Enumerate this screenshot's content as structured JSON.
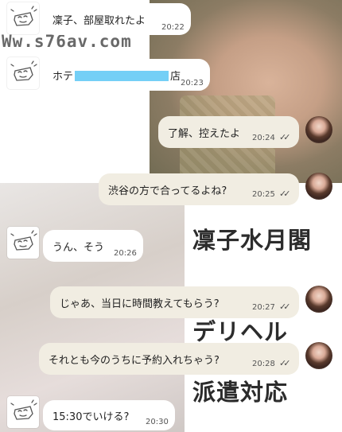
{
  "watermark": "Ww.s76av.com",
  "poster": {
    "line1": "凜子水月閣",
    "line2": "デリヘル",
    "line3": "派遣対応"
  },
  "messages": [
    {
      "from": "shop",
      "text": "凜子、部屋取れたよ",
      "time": "20:22"
    },
    {
      "from": "shop",
      "text_before": "ホテ",
      "text_after": "店",
      "time": "20:23"
    },
    {
      "from": "user",
      "text": "了解、控えたよ",
      "time": "20:24",
      "status": "read"
    },
    {
      "from": "user",
      "text": "渋谷の方で合ってるよね?",
      "time": "20:25",
      "status": "read"
    },
    {
      "from": "shop",
      "text": "うん、そう",
      "time": "20:26"
    },
    {
      "from": "user",
      "text": "じゃあ、当日に時間教えてもらう?",
      "time": "20:27",
      "status": "read"
    },
    {
      "from": "user",
      "text": "それとも今のうちに予約入れちゃう?",
      "time": "20:28",
      "status": "read"
    },
    {
      "from": "shop",
      "text": "15:30でいける?",
      "time": "20:30"
    }
  ],
  "colors": {
    "bot_bubble": "#ffffff",
    "user_bubble": "#f1ede2",
    "redaction": "#74cff6"
  },
  "icons": {
    "shop_avatar": "sketch-doodle-avatar-icon",
    "user_avatar": "profile-photo-avatar",
    "read_status": "double-check-icon"
  }
}
